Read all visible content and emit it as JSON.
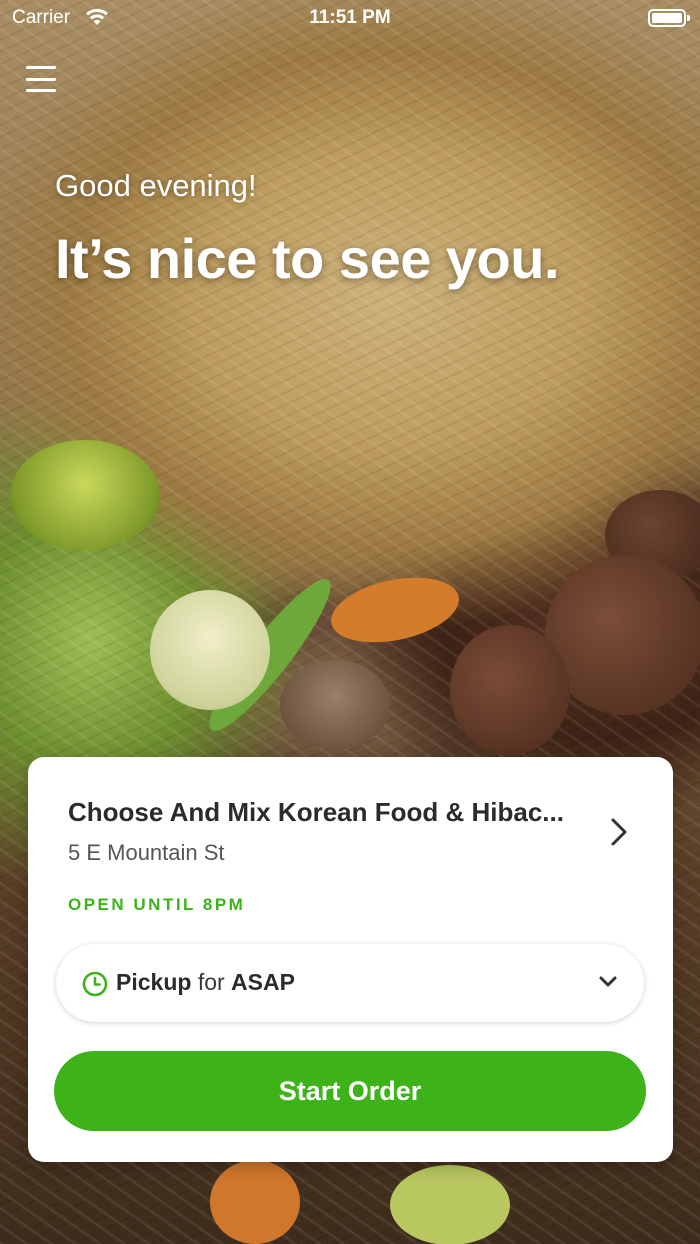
{
  "status_bar": {
    "carrier": "Carrier",
    "time": "11:51 PM",
    "icons": [
      "wifi-icon",
      "battery-icon"
    ]
  },
  "header": {
    "menu_icon": "hamburger-menu-icon"
  },
  "greeting": {
    "subtitle": "Good evening!",
    "title": "It’s nice to see you."
  },
  "restaurant": {
    "name": "Choose And Mix Korean Food & Hibac...",
    "address": "5 E Mountain St",
    "open_status": "OPEN UNTIL 8PM"
  },
  "order_options": {
    "mode": "Pickup",
    "connector": "for",
    "time": "ASAP"
  },
  "actions": {
    "start_order_label": "Start Order"
  },
  "colors": {
    "accent": "#3db219",
    "text_dark": "#2b2b2b",
    "text_muted": "#555555"
  }
}
